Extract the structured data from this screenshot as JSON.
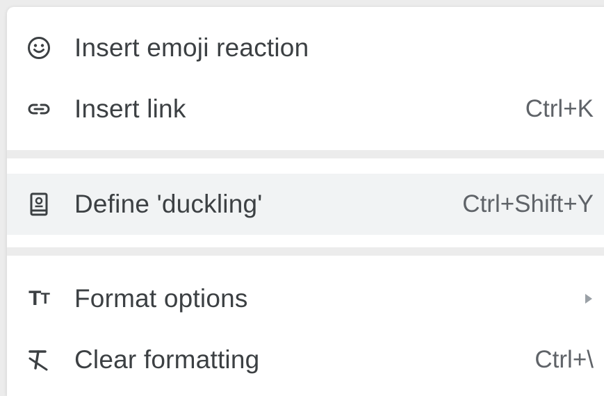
{
  "context_menu": {
    "items": [
      {
        "label": "Insert emoji reaction",
        "shortcut": "",
        "icon": "smiley-icon"
      },
      {
        "label": "Insert link",
        "shortcut": "Ctrl+K",
        "icon": "link-icon"
      },
      {
        "label": "Define 'duckling'",
        "shortcut": "Ctrl+Shift+Y",
        "icon": "dictionary-icon",
        "highlighted": true
      },
      {
        "label": "Format options",
        "shortcut": "",
        "icon": "text-format-icon",
        "has_submenu": true
      },
      {
        "label": "Clear formatting",
        "shortcut": "Ctrl+\\",
        "icon": "clear-formatting-icon"
      }
    ],
    "format_icon_text": {
      "big": "T",
      "small": "T"
    }
  },
  "colors": {
    "menu_background": "#ffffff",
    "highlight": "#f1f3f4",
    "divider": "#ececec",
    "label_text": "#3c4043",
    "shortcut_text": "#5f6368"
  }
}
